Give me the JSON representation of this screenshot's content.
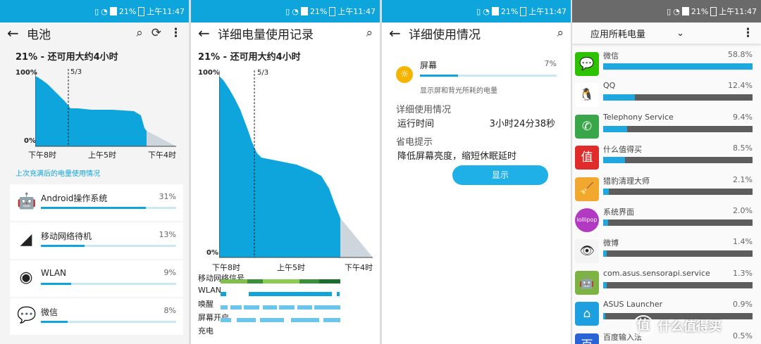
{
  "status_bar": {
    "battery_pct": "21%",
    "time": "上午11:47",
    "sim_label": "2G"
  },
  "panel1": {
    "title": "电池",
    "summary": "21% - 还可用大约4小时",
    "chart": {
      "y_top": "100%",
      "y_bottom": "0%",
      "marker": "5/3",
      "x_labels": [
        "下午8时",
        "上午5时",
        "下午4时"
      ]
    },
    "link": "上次充满后的电量使用情况",
    "items": [
      {
        "name": "Android操作系统",
        "pct": "31%",
        "value": 31,
        "icon": "android-icon"
      },
      {
        "name": "移动网络待机",
        "pct": "13%",
        "value": 13,
        "icon": "signal-icon"
      },
      {
        "name": "WLAN",
        "pct": "9%",
        "value": 9,
        "icon": "wifi-icon"
      },
      {
        "name": "微信",
        "pct": "8%",
        "value": 8,
        "icon": "wechat-icon"
      }
    ]
  },
  "panel2": {
    "title": "详细电量使用记录",
    "summary": "21% - 还可用大约4小时",
    "chart": {
      "y_top": "100%",
      "y_bottom": "0%",
      "marker": "5/3",
      "x_labels": [
        "下午8时",
        "上午5时",
        "下午4时"
      ]
    },
    "rows": [
      "移动网络信号",
      "WLAN",
      "唤醒",
      "屏幕开启",
      "充电"
    ]
  },
  "panel3": {
    "title": "详细使用情况",
    "item": {
      "name": "屏幕",
      "pct": "7%",
      "value": 7,
      "desc": "显示屏和背光所耗的电量"
    },
    "usage_header": "详细使用情况",
    "runtime_label": "运行时间",
    "runtime_value": "3小时24分38秒",
    "tip_header": "省电提示",
    "tip": "降低屏幕亮度，缩短休眠延时",
    "button": "显示"
  },
  "panel4": {
    "dropdown": "应用所耗电量",
    "apps": [
      {
        "name": "微信",
        "pct": "58.8%",
        "value": 58.8,
        "icon": "wechat-icon",
        "color": "#2dc100",
        "glyph": "💬"
      },
      {
        "name": "QQ",
        "pct": "12.4%",
        "value": 12.4,
        "icon": "qq-penguin-icon",
        "color": "#ffffff",
        "glyph": "🐧"
      },
      {
        "name": "Telephony Service",
        "pct": "9.4%",
        "value": 9.4,
        "icon": "phone-icon",
        "color": "#3aa64a",
        "glyph": "✆"
      },
      {
        "name": "什么值得买",
        "pct": "8.5%",
        "value": 8.5,
        "icon": "smzdm-icon",
        "color": "#e02b2b",
        "glyph": "值"
      },
      {
        "name": "猎豹清理大师",
        "pct": "2.1%",
        "value": 2.1,
        "icon": "broom-icon",
        "color": "#f2a72e",
        "glyph": "🧹"
      },
      {
        "name": "系统界面",
        "pct": "2.0%",
        "value": 2.0,
        "icon": "lollipop-icon",
        "color": "#b23ac2",
        "glyph": "lollipop"
      },
      {
        "name": "微博",
        "pct": "1.4%",
        "value": 1.4,
        "icon": "weibo-icon",
        "color": "#f4f4f4",
        "glyph": "👁"
      },
      {
        "name": "com.asus.sensorapi.service",
        "pct": "1.3%",
        "value": 1.3,
        "icon": "android-icon",
        "color": "#7cb342",
        "glyph": "🤖"
      },
      {
        "name": "ASUS Launcher",
        "pct": "0.9%",
        "value": 0.9,
        "icon": "home-icon",
        "color": "#1e9fe0",
        "glyph": "⌂"
      },
      {
        "name": "百度输入法",
        "pct": "0.5%",
        "value": 0.5,
        "icon": "baidu-icon",
        "color": "#2a63d6",
        "glyph": "百"
      }
    ]
  },
  "watermark": {
    "text": "什么值得买",
    "badge": "值"
  }
}
